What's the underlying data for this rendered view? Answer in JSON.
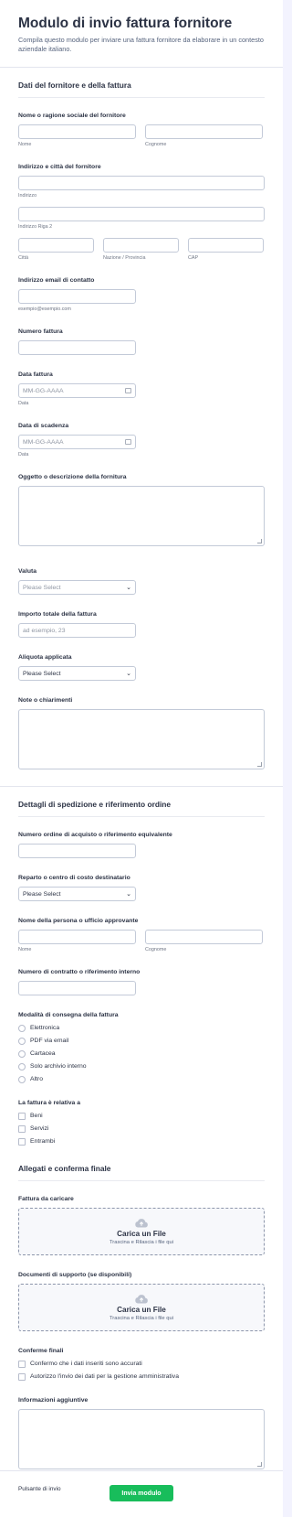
{
  "header": {
    "title": "Modulo di invio fattura fornitore",
    "subtitle": "Compila questo modulo per inviare una fattura fornitore da elaborare in un contesto aziendale italiano."
  },
  "section1": {
    "heading": "Dati del fornitore e della fattura",
    "supplier_name": {
      "label": "Nome o ragione sociale del fornitore",
      "first_sub": "Nome",
      "last_sub": "Cognome"
    },
    "address": {
      "label": "Indirizzo e città del fornitore",
      "line1_sub": "Indirizzo",
      "line2_sub": "Indirizzo Riga 2",
      "city_sub": "Città",
      "state_sub": "Nazione / Provincia",
      "zip_sub": "CAP"
    },
    "email": {
      "label": "Indirizzo email di contatto",
      "sub": "esempio@esempio.com"
    },
    "invoice_number": {
      "label": "Numero fattura"
    },
    "invoice_date": {
      "label": "Data fattura",
      "placeholder": "MM-GG-AAAA",
      "sub": "Data"
    },
    "due_date": {
      "label": "Data di scadenza",
      "placeholder": "MM-GG-AAAA",
      "sub": "Data"
    },
    "description": {
      "label": "Oggetto o descrizione della fornitura"
    },
    "currency": {
      "label": "Valuta",
      "value": "Please Select"
    },
    "total": {
      "label": "Importo totale della fattura",
      "placeholder": "ad esempio, 23"
    },
    "vat": {
      "label": "Aliquota applicata",
      "value": "Please Select"
    },
    "notes": {
      "label": "Note o chiarimenti"
    }
  },
  "section2": {
    "heading": "Dettagli di spedizione e riferimento ordine",
    "po_number": {
      "label": "Numero ordine di acquisto o riferimento equivalente"
    },
    "department": {
      "label": "Reparto o centro di costo destinatario",
      "value": "Please Select"
    },
    "approver": {
      "label": "Nome della persona o ufficio approvante",
      "first_sub": "Nome",
      "last_sub": "Cognome"
    },
    "contract": {
      "label": "Numero di contratto o riferimento interno"
    },
    "delivery": {
      "label": "Modalità di consegna della fattura",
      "options": [
        "Elettronica",
        "PDF via email",
        "Cartacea",
        "Solo archivio interno",
        "Altro"
      ]
    },
    "relates": {
      "label": "La fattura è relativa a",
      "options": [
        "Beni",
        "Servizi",
        "Entrambi"
      ]
    }
  },
  "section3": {
    "heading": "Allegati e conferma finale",
    "invoice_upload": {
      "label": "Fattura da caricare",
      "title": "Carica un File",
      "sub": "Trascina e Rilascia i file qui"
    },
    "support_upload": {
      "label": "Documenti di supporto (se disponibili)",
      "title": "Carica un File",
      "sub": "Trascina e Rilascia i file qui"
    },
    "confirm": {
      "label": "Conferme finali",
      "options": [
        "Confermo che i dati inseriti sono accurati",
        "Autorizzo l'invio dei dati per la gestione amministrativa"
      ]
    },
    "extra": {
      "label": "Informazioni aggiuntive"
    },
    "submit_label": "Pulsante di invio"
  },
  "footer": {
    "submit": "Invia modulo"
  },
  "colors": {
    "accent": "#18bd5b",
    "text": "#2c3345",
    "border": "#c3cad8"
  },
  "icons": {
    "upload": "cloud-upload-icon",
    "chevron": "chevron-down-icon",
    "calendar": "calendar-icon"
  }
}
